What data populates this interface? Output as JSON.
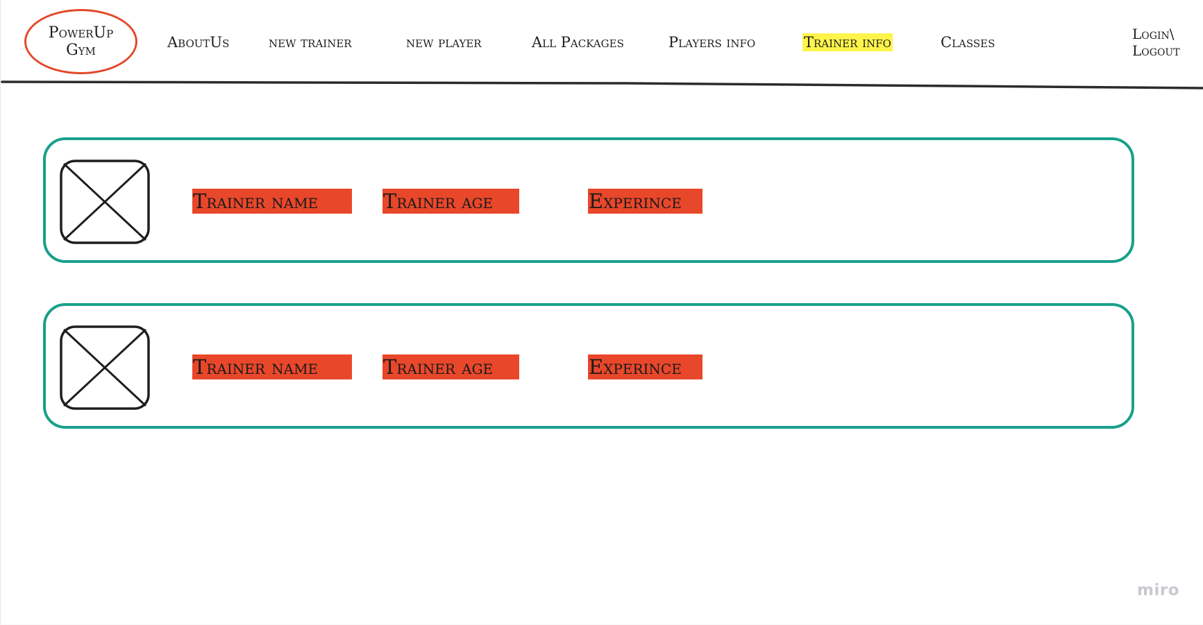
{
  "logo": {
    "line1": "PowerUp",
    "line2": "Gym",
    "border_color": "#e2492a"
  },
  "nav": {
    "items": [
      {
        "label": "AboutUs"
      },
      {
        "label": "new trainer"
      },
      {
        "label": "new player"
      },
      {
        "label": "All Packages"
      },
      {
        "label": "Players info"
      },
      {
        "label": "Trainer info",
        "active": true,
        "highlight_color": "#fff44a"
      },
      {
        "label": "Classes"
      }
    ],
    "login_line1": "Login\\",
    "login_line2": "Logout"
  },
  "trainers": [
    {
      "image_icon": "image-placeholder-icon",
      "name_label": "Trainer name",
      "age_label": "Trainer age",
      "experience_label": "Experince"
    },
    {
      "image_icon": "image-placeholder-icon",
      "name_label": "Trainer name",
      "age_label": "Trainer age",
      "experience_label": "Experince"
    }
  ],
  "colors": {
    "card_border": "#18a08a",
    "field_background": "#e9472a"
  },
  "watermark": "miro"
}
